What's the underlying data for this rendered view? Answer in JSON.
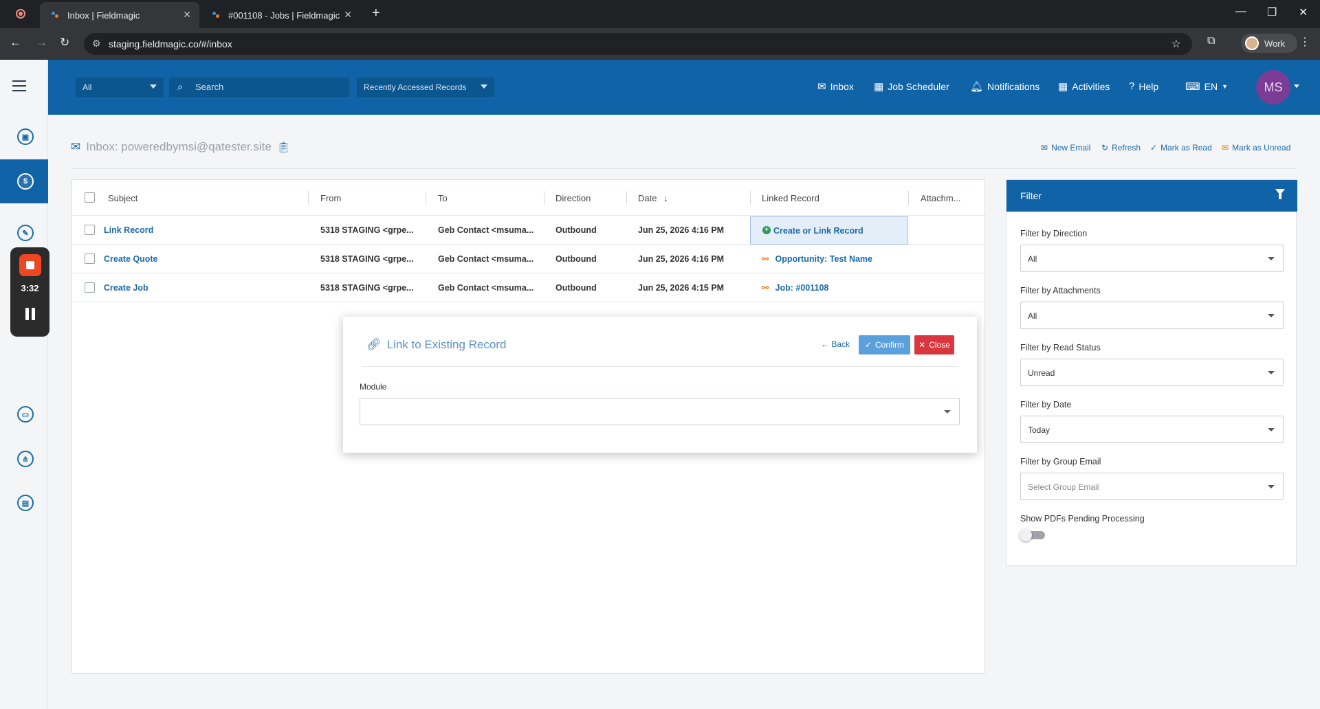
{
  "browser": {
    "tabs": [
      {
        "title": "Inbox | Fieldmagic",
        "active": true
      },
      {
        "title": "#001108 - Jobs | Fieldmagic",
        "active": false
      }
    ],
    "url": "staging.fieldmagic.co/#/inbox",
    "profile_label": "Work"
  },
  "recorder": {
    "time": "3:32"
  },
  "header": {
    "scope_select": "All",
    "search_placeholder": "Search",
    "recent_select": "Recently Accessed Records",
    "nav": {
      "inbox": "Inbox",
      "job_scheduler": "Job Scheduler",
      "notifications": "Notifications",
      "activities": "Activities",
      "help": "Help",
      "language": "EN"
    },
    "avatar_initials": "MS"
  },
  "page": {
    "title": "Inbox: poweredbymsi@qatester.site",
    "actions": {
      "new_email": "New Email",
      "refresh": "Refresh",
      "mark_read": "Mark as Read",
      "mark_unread": "Mark as Unread"
    }
  },
  "table": {
    "columns": {
      "subject": "Subject",
      "from": "From",
      "to": "To",
      "direction": "Direction",
      "date": "Date",
      "linked": "Linked Record",
      "attachments": "Attachm..."
    },
    "rows": [
      {
        "subject": "Link Record",
        "from": "5318 STAGING <grpe...",
        "to": "Geb Contact <msuma...",
        "direction": "Outbound",
        "date": "Jun 25, 2026 4:16 PM",
        "linked": "Create or Link Record"
      },
      {
        "subject": "Create Quote",
        "from": "5318 STAGING <grpe...",
        "to": "Geb Contact <msuma...",
        "direction": "Outbound",
        "date": "Jun 25, 2026 4:16 PM",
        "linked": "Opportunity: Test Name"
      },
      {
        "subject": "Create Job",
        "from": "5318 STAGING <grpe...",
        "to": "Geb Contact <msuma...",
        "direction": "Outbound",
        "date": "Jun 25, 2026 4:15 PM",
        "linked": "Job: #001108"
      }
    ]
  },
  "modal": {
    "title": "Link to Existing Record",
    "back": "Back",
    "confirm": "Confirm",
    "close": "Close",
    "module_label": "Module",
    "module_value": ""
  },
  "filter": {
    "title": "Filter",
    "direction_label": "Filter by Direction",
    "direction_value": "All",
    "attachments_label": "Filter by Attachments",
    "attachments_value": "All",
    "read_status_label": "Filter by Read Status",
    "read_status_value": "Unread",
    "date_label": "Filter by Date",
    "date_value": "Today",
    "group_email_label": "Filter by Group Email",
    "group_email_placeholder": "Select Group Email",
    "pdf_toggle_label": "Show PDFs Pending Processing",
    "pdf_toggle_on": false
  },
  "colors": {
    "brand_blue": "#0f63a6",
    "link_blue": "#1a6aa8",
    "confirm_blue": "#5aa0dc",
    "close_red": "#d9363e",
    "avatar_purple": "#7b3c96"
  }
}
